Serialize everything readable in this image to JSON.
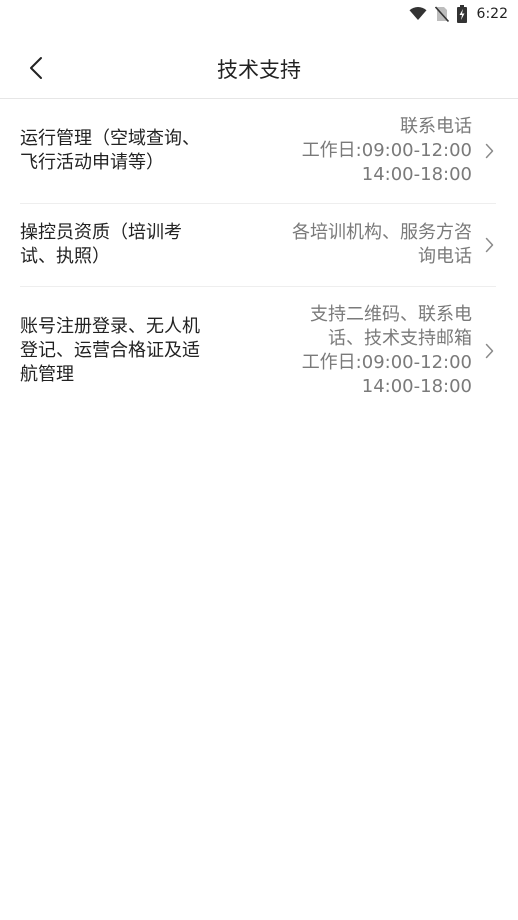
{
  "status_bar": {
    "time": "6:22",
    "icons": [
      "wifi-icon",
      "no-sim-icon",
      "battery-charging-icon"
    ]
  },
  "header": {
    "title": "技术支持",
    "back_icon": "chevron-left-icon"
  },
  "items": [
    {
      "label_lines": [
        "运行管理（空域查询、",
        "飞行活动申请等）"
      ],
      "detail_lines": [
        "联系电话",
        "工作日:09:00-12:00",
        "14:00-18:00"
      ]
    },
    {
      "label_lines": [
        "操控员资质（培训考",
        "试、执照）"
      ],
      "detail_lines": [
        "各培训机构、服务方咨",
        "询电话"
      ]
    },
    {
      "label_lines": [
        "账号注册登录、无人机",
        "登记、运营合格证及适",
        "航管理"
      ],
      "detail_lines": [
        "支持二维码、联系电",
        "话、技术支持邮箱",
        "工作日:09:00-12:00",
        "14:00-18:00"
      ]
    }
  ],
  "colors": {
    "text_primary": "#222222",
    "text_secondary": "#7a7a7a",
    "divider": "#eeeeee"
  }
}
